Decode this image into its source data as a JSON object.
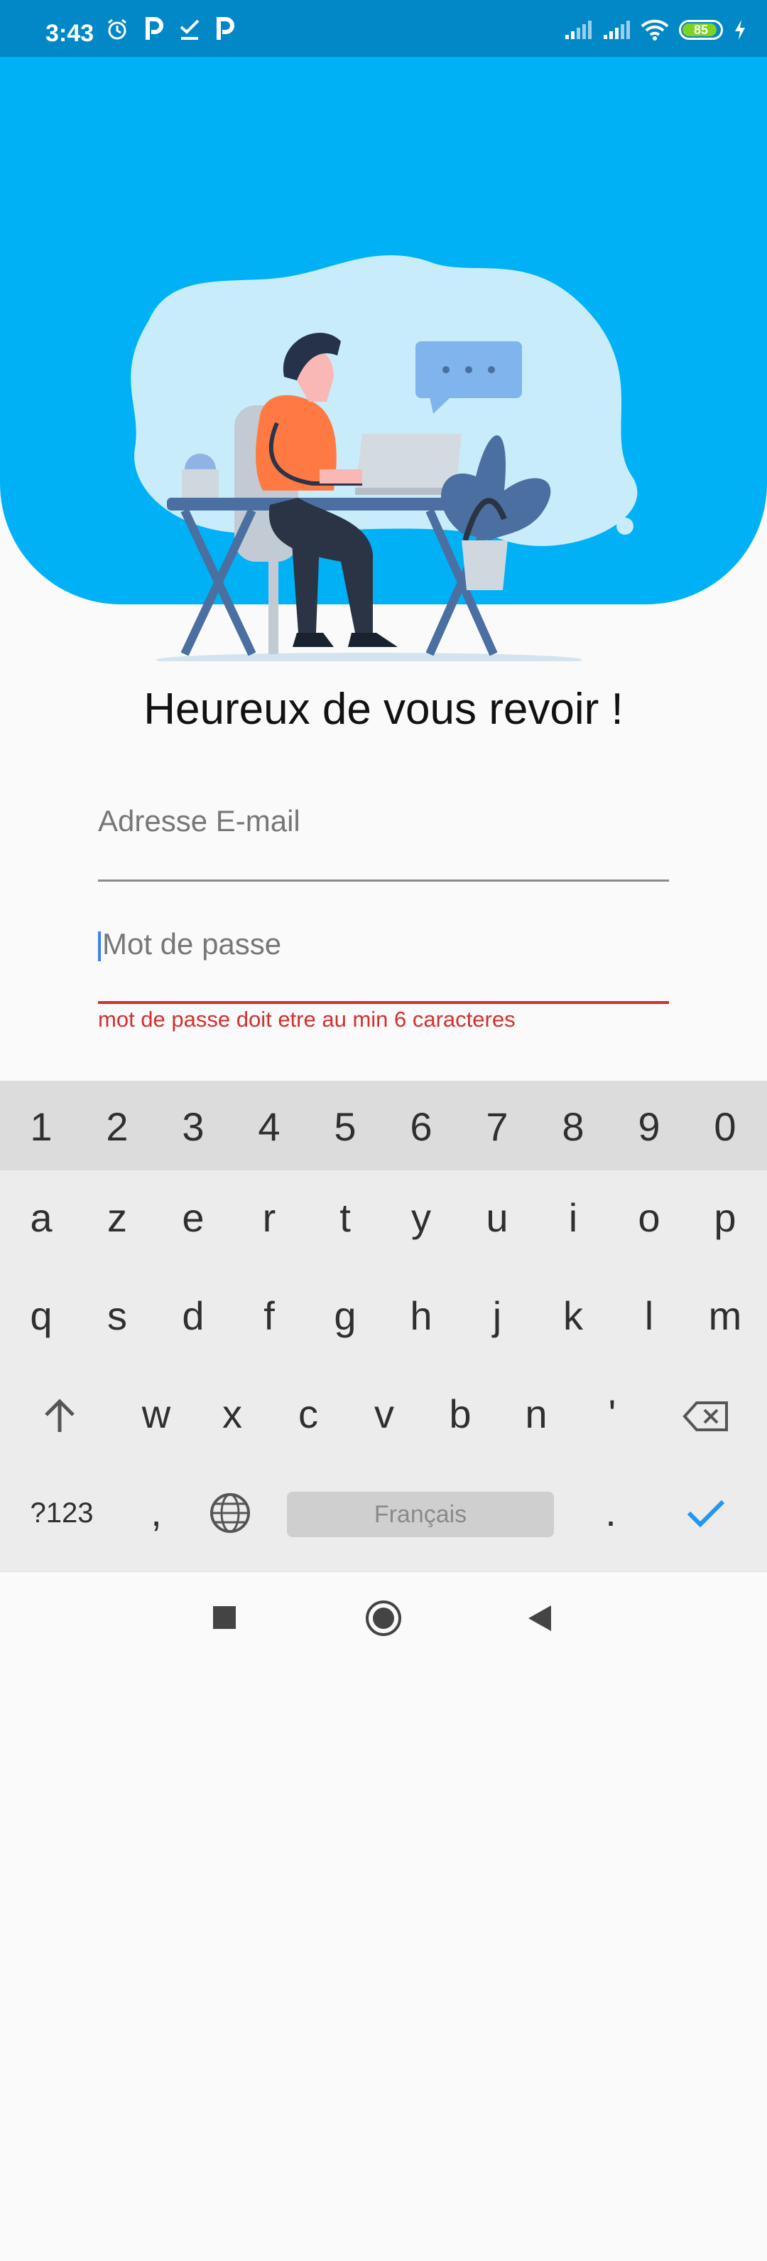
{
  "status_bar": {
    "time": "3:43",
    "left_icons": [
      "alarm-icon",
      "p-app-icon",
      "check-icon",
      "p-app-icon"
    ],
    "battery_level": "85",
    "right_icons": [
      "signal-icon",
      "signal-icon",
      "wifi-icon",
      "battery-icon",
      "charging-icon"
    ]
  },
  "login": {
    "heading": "Heureux de vous revoir !",
    "email_placeholder": "Adresse E-mail",
    "password_placeholder": "Mot de passe",
    "error_message": "mot de passe doit etre au min 6 caracteres"
  },
  "keyboard": {
    "number_row": [
      "1",
      "2",
      "3",
      "4",
      "5",
      "6",
      "7",
      "8",
      "9",
      "0"
    ],
    "row1": [
      "a",
      "z",
      "e",
      "r",
      "t",
      "y",
      "u",
      "i",
      "o",
      "p"
    ],
    "row2": [
      "q",
      "s",
      "d",
      "f",
      "g",
      "h",
      "j",
      "k",
      "l",
      "m"
    ],
    "row3": [
      "w",
      "x",
      "c",
      "v",
      "b",
      "n",
      "'"
    ],
    "symbols_key": "?123",
    "comma_key": ",",
    "period_key": ".",
    "space_label": "Français"
  },
  "colors": {
    "hero": "#00b1f5",
    "status_bar": "#0288c7",
    "error": "#d32f2f",
    "accent": "#2196f3"
  }
}
